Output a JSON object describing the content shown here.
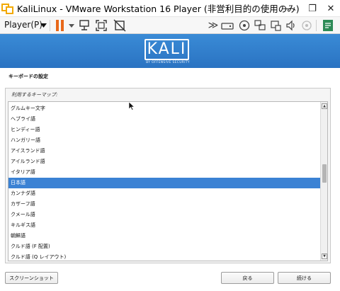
{
  "window": {
    "title": "KaliLinux - VMware Workstation 16 Player (非営利目的の使用のみ)",
    "controls": [
      "—",
      "❐",
      "✕"
    ]
  },
  "toolbar": {
    "player_menu": "Player(P)",
    "accent_color": "#e8681a",
    "fast_forward": "≫"
  },
  "banner": {
    "logo_text": "KALI",
    "logo_subtext": "BY OFFENSIVE SECURITY",
    "color": "#2a73c2"
  },
  "page": {
    "section_title": "キーボードの設定",
    "list_label": "利用するキーマップ:",
    "selected_color": "#3b82d4",
    "keymaps": [
      "グルムキー文字",
      "ヘブライ語",
      "ヒンディー語",
      "ハンガリー語",
      "アイスランド語",
      "アイルランド語",
      "イタリア語",
      "日本語",
      "カンナダ語",
      "カザーフ語",
      "クメール語",
      "キルギス語",
      "朝鮮語",
      "クルド語 (F 配置)",
      "クルド語 (Q レイアウト)"
    ],
    "selected_keymap": "日本語"
  },
  "buttons": {
    "screenshot": "スクリーンショット",
    "back": "戻る",
    "continue": "続ける"
  }
}
